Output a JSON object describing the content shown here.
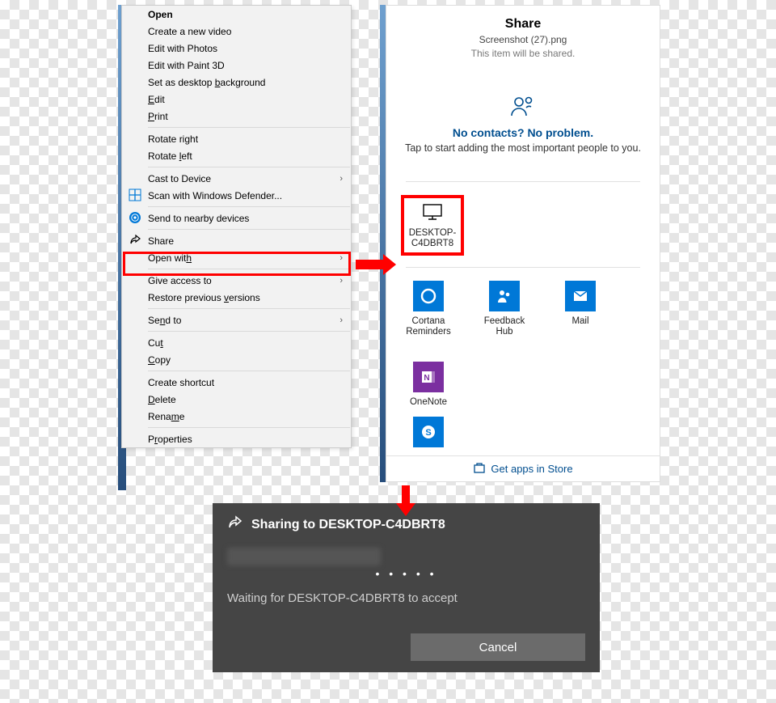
{
  "context_menu": {
    "open": "Open",
    "create_video": "Create a new video",
    "edit_photos": "Edit with Photos",
    "edit_paint3d": "Edit with Paint 3D",
    "set_background_pre": "Set as desktop ",
    "set_background_u": "b",
    "set_background_post": "ackground",
    "edit_u": "E",
    "edit_post": "dit",
    "print_u": "P",
    "print_post": "rint",
    "rotate_right_pre": "Rotate ri",
    "rotate_right_u": "g",
    "rotate_right_post": "ht",
    "rotate_left_pre": "Rotate ",
    "rotate_left_u": "l",
    "rotate_left_post": "eft",
    "cast": "Cast to Device",
    "defender": "Scan with Windows Defender...",
    "nearby": "Send to nearby devices",
    "share": "Share",
    "open_with_pre": "Open wit",
    "open_with_u": "h",
    "give_access": "Give access to",
    "restore_pre": "Restore previous ",
    "restore_u": "v",
    "restore_post": "ersions",
    "send_to_pre": "Se",
    "send_to_u": "n",
    "send_to_post": "d to",
    "cut_pre": "Cu",
    "cut_u": "t",
    "copy_u": "C",
    "copy_post": "opy",
    "shortcut": "Create shortcut",
    "delete_u": "D",
    "delete_post": "elete",
    "rename_pre": "Rena",
    "rename_u": "m",
    "rename_post": "e",
    "properties_pre": "P",
    "properties_u": "r",
    "properties_post": "operties",
    "chevron": "›"
  },
  "share_panel": {
    "title": "Share",
    "file": "Screenshot (27).png",
    "subtitle": "This item will be shared.",
    "no_contacts": "No contacts? No problem.",
    "tap": "Tap to start adding the most important people to you.",
    "device": "DESKTOP-C4DBRT8",
    "apps": {
      "cortana": "Cortana Reminders",
      "feedback": "Feedback Hub",
      "mail": "Mail",
      "onenote": "OneNote",
      "skype": "Skype"
    },
    "store": "Get apps in Store"
  },
  "toast": {
    "title": "Sharing to DESKTOP-C4DBRT8",
    "dots": "• • • • •",
    "waiting": "Waiting for DESKTOP-C4DBRT8 to accept",
    "cancel": "Cancel"
  },
  "colors": {
    "cortana": "#0078d7",
    "feedback": "#0078d7",
    "mail": "#0078d7",
    "onenote": "#7b2fa0",
    "skype": "#0078d7",
    "accent": "#ff0000"
  }
}
